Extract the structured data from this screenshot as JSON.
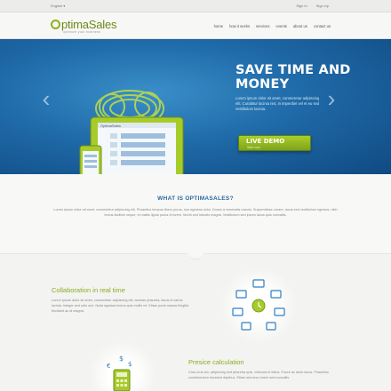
{
  "topbar": {
    "language": "English ▾",
    "login": "Sign In",
    "signup": "Sign Up"
  },
  "logo": {
    "brand": "ptimaSales",
    "tagline": "optimize your business"
  },
  "nav": [
    "home",
    "how it works",
    "services",
    "events",
    "about us",
    "contact us"
  ],
  "hero": {
    "title": "SAVE TIME AND MONEY",
    "description": "Lorem ipsum dolor sit amet, consectetur adipiscing elit. Curabitur lacinia nisi, in imperdiet vel et eu sed vestibulum lacinia.",
    "cta_label": "LIVE DEMO",
    "cta_sub": "Start now",
    "prev": "‹",
    "next": "›",
    "tablet_header": "OptimaSales"
  },
  "about": {
    "title": "WHAT IS OPTIMASALES?",
    "text": "Lorem ipsum dolor sit amet, consectetur adipiscing elit. Phasellus tempus libero purus, non egestas dolor. Donec a venenatis mauris. Suspendisse ornare, lacus sed vestibulum egestas, nibh lectus facilisis neque, et mattis ligula purus et lorem. Morbi sed lobortis magna. Vestibulum sed ipsum lacus quis convallis."
  },
  "features": [
    {
      "title": "Collaboration in real time",
      "text": "Lorem ipsum dolor sit amet, consectetur adipiscing elit, aenean pharetra, lacus id varius lacinia. Integer sed odio orci. Nulla egestas lectus quis mollis mi. Etiam porta massa fringilla tincidunt ac id magna."
    },
    {
      "title": "Presice calculation",
      "text": "Cras urna leo, adipiscing sed pharetra quis, vehicula et tellus. Fusce ac dolor lacus. Phasellus condimentum tincidunt dapibus. Etiam sed arcu lorem sed convallis."
    }
  ],
  "colors": {
    "brand_green": "#8fb21e",
    "hero_blue": "#1f6aa8",
    "heading_blue": "#2a6aa2"
  }
}
